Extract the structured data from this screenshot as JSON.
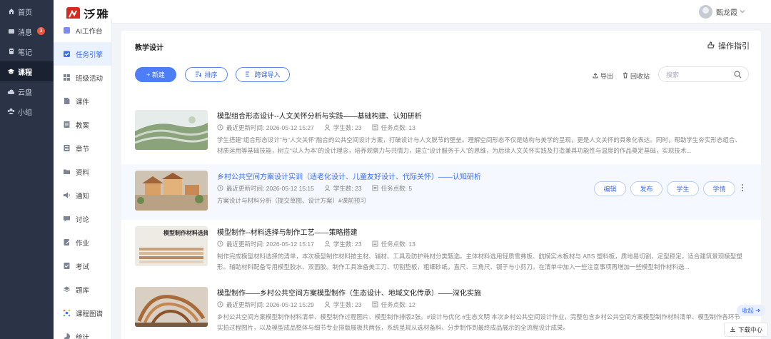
{
  "app": {
    "name": "泛雅",
    "user_name": "甄龙霞"
  },
  "nav": {
    "items": [
      {
        "label": "首页",
        "icon": "home-icon"
      },
      {
        "label": "消息",
        "icon": "message-icon",
        "badge": "3"
      },
      {
        "label": "笔记",
        "icon": "note-icon"
      },
      {
        "label": "课程",
        "icon": "course-icon",
        "active": true
      },
      {
        "label": "云盘",
        "icon": "cloud-icon"
      },
      {
        "label": "小组",
        "icon": "group-icon"
      }
    ]
  },
  "submenu": {
    "items": [
      {
        "label": "AI工作台",
        "icon": "ai-icon"
      },
      {
        "label": "任务引擎",
        "icon": "task-icon",
        "active": true
      },
      {
        "label": "班级活动",
        "icon": "grid-icon"
      },
      {
        "label": "课件",
        "icon": "file-icon"
      },
      {
        "label": "教案",
        "icon": "plan-icon"
      },
      {
        "label": "章节",
        "icon": "chapter-icon"
      },
      {
        "label": "资料",
        "icon": "folder-icon"
      },
      {
        "label": "通知",
        "icon": "speaker-icon"
      },
      {
        "label": "讨论",
        "icon": "chat-icon"
      },
      {
        "label": "作业",
        "icon": "homework-icon"
      },
      {
        "label": "考试",
        "icon": "exam-icon"
      },
      {
        "label": "题库",
        "icon": "bank-icon"
      },
      {
        "label": "课程图谱",
        "icon": "graph-icon"
      },
      {
        "label": "统计",
        "icon": "stats-icon"
      }
    ]
  },
  "panel": {
    "title": "教学设计",
    "guide_label": "操作指引",
    "new_label": "+ 新建",
    "sort_label": "排序",
    "import_label": "跨课导入",
    "export_label": "导出",
    "recycle_label": "回收站",
    "search_placeholder": "搜索"
  },
  "meta_labels": {
    "updated": "最近更新时间:",
    "students": "学生数:",
    "tasks": "任务点数:"
  },
  "courses": [
    {
      "title": "模型组合形态设计--人文关怀分析与实践——基础构建、认知研析",
      "updated": "2026-05-12 15:27",
      "students": "23",
      "tasks": "13",
      "desc": "学生搭建“组合形态设计”与“人文关怀”融合的公共空间设计方案，打破设计与人文脱节的壁垒。理解空间形态不仅是结构与美学的呈现，更是人文关怀的具象化表达。同时，帮助学生夯实形态组合、材质运用等基础技能，树立“以人为本”的设计理念，培养观察力与共情力，建立“设计服务于人”的思维，为后续人文关怀实践及打造兼具功能性与温度的作品奠定基础，实现技术...",
      "hover": false
    },
    {
      "title": "乡村公共空间方案设计实训（适老化设计、儿童友好设计、代际关怀）——认知研析",
      "updated": "2026-05-12 15:15",
      "students": "23",
      "tasks": "5",
      "desc": "方案设计与材料分析（提交草图、设计方案）#课前预习",
      "hover": true,
      "actions": [
        "编辑",
        "发布",
        "学生",
        "学情"
      ]
    },
    {
      "title": "模型制作--材料选择与制作工艺——策略搭建",
      "updated": "2026-05-12 15:17",
      "students": "23",
      "tasks": "13",
      "desc": "制作完成模型材料选择的清单，本次模型制作材料按主材、辅材、工具及防护耗材分类甄选。主体材料选用轻质雪弗板、航模实木板材与 ABS 塑料板，质地易切割、定型稳定，适合建筑景观模型塑形。辅助材料配备专用模型胶水、双面胶。制作工具准备美工刀、切割垫板，粗细砂纸，直尺、三角尺、镊子与小剪刀。在清单中加入一些注意事项再增加一些模型制作材料选...",
      "hover": false,
      "thumb_text": "模型制作材料选择"
    },
    {
      "title": "模型制作——乡村公共空间方案模型制作（生态设计、地域文化传承）——深化实施",
      "updated": "2026-05-12 15:29",
      "students": "23",
      "tasks": "12",
      "desc": "乡村公共空间方案模型制作材料清单、模型制作过程图片、模型制作排版2张。#设计与优化 #生态文明 本次乡村公共空间设计作业，完整包含乡村公共空间方案模型制作材料清单、模型制作各环节实拍过程图片，以及模型成品整体与细节专业排版展板共两张，系统呈现从选材备料、分步制作到最终成品展示的全流程设计成果。",
      "hover": false
    }
  ],
  "float": {
    "collapse_label": "收起",
    "download_label": "下载中心"
  },
  "colors": {
    "accent": "#3b6cf6",
    "nav_bg": "#2a3446",
    "brand_red": "#d9281e"
  }
}
